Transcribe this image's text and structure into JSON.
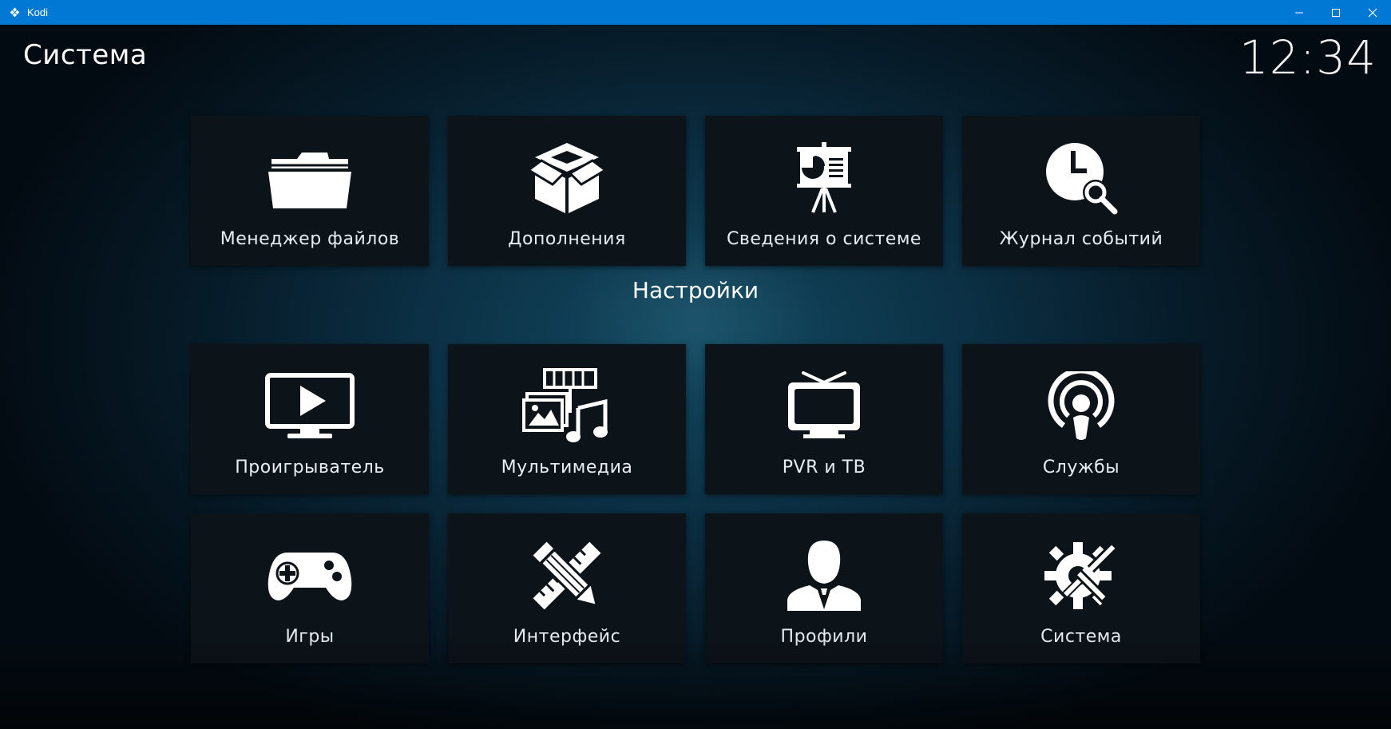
{
  "window": {
    "title": "Kodi"
  },
  "header": {
    "title": "Система",
    "clock": "12:34"
  },
  "sections": {
    "settings_title": "Настройки"
  },
  "tiles": [
    {
      "label": "Менеджер файлов",
      "icon": "folder-icon"
    },
    {
      "label": "Дополнения",
      "icon": "addons-box-icon"
    },
    {
      "label": "Сведения о системе",
      "icon": "presentation-board-icon"
    },
    {
      "label": "Журнал событий",
      "icon": "clock-search-icon"
    },
    {
      "label": "Проигрыватель",
      "icon": "tv-play-icon"
    },
    {
      "label": "Мультимедиа",
      "icon": "media-icon"
    },
    {
      "label": "PVR и ТВ",
      "icon": "tv-antenna-icon"
    },
    {
      "label": "Службы",
      "icon": "podcast-icon"
    },
    {
      "label": "Игры",
      "icon": "gamepad-icon"
    },
    {
      "label": "Интерфейс",
      "icon": "pencil-ruler-icon"
    },
    {
      "label": "Профили",
      "icon": "user-profile-icon"
    },
    {
      "label": "Система",
      "icon": "gear-tools-icon"
    }
  ],
  "colors": {
    "titlebar": "#0078d4",
    "tile": "#0c1319",
    "text": "#ffffff"
  }
}
